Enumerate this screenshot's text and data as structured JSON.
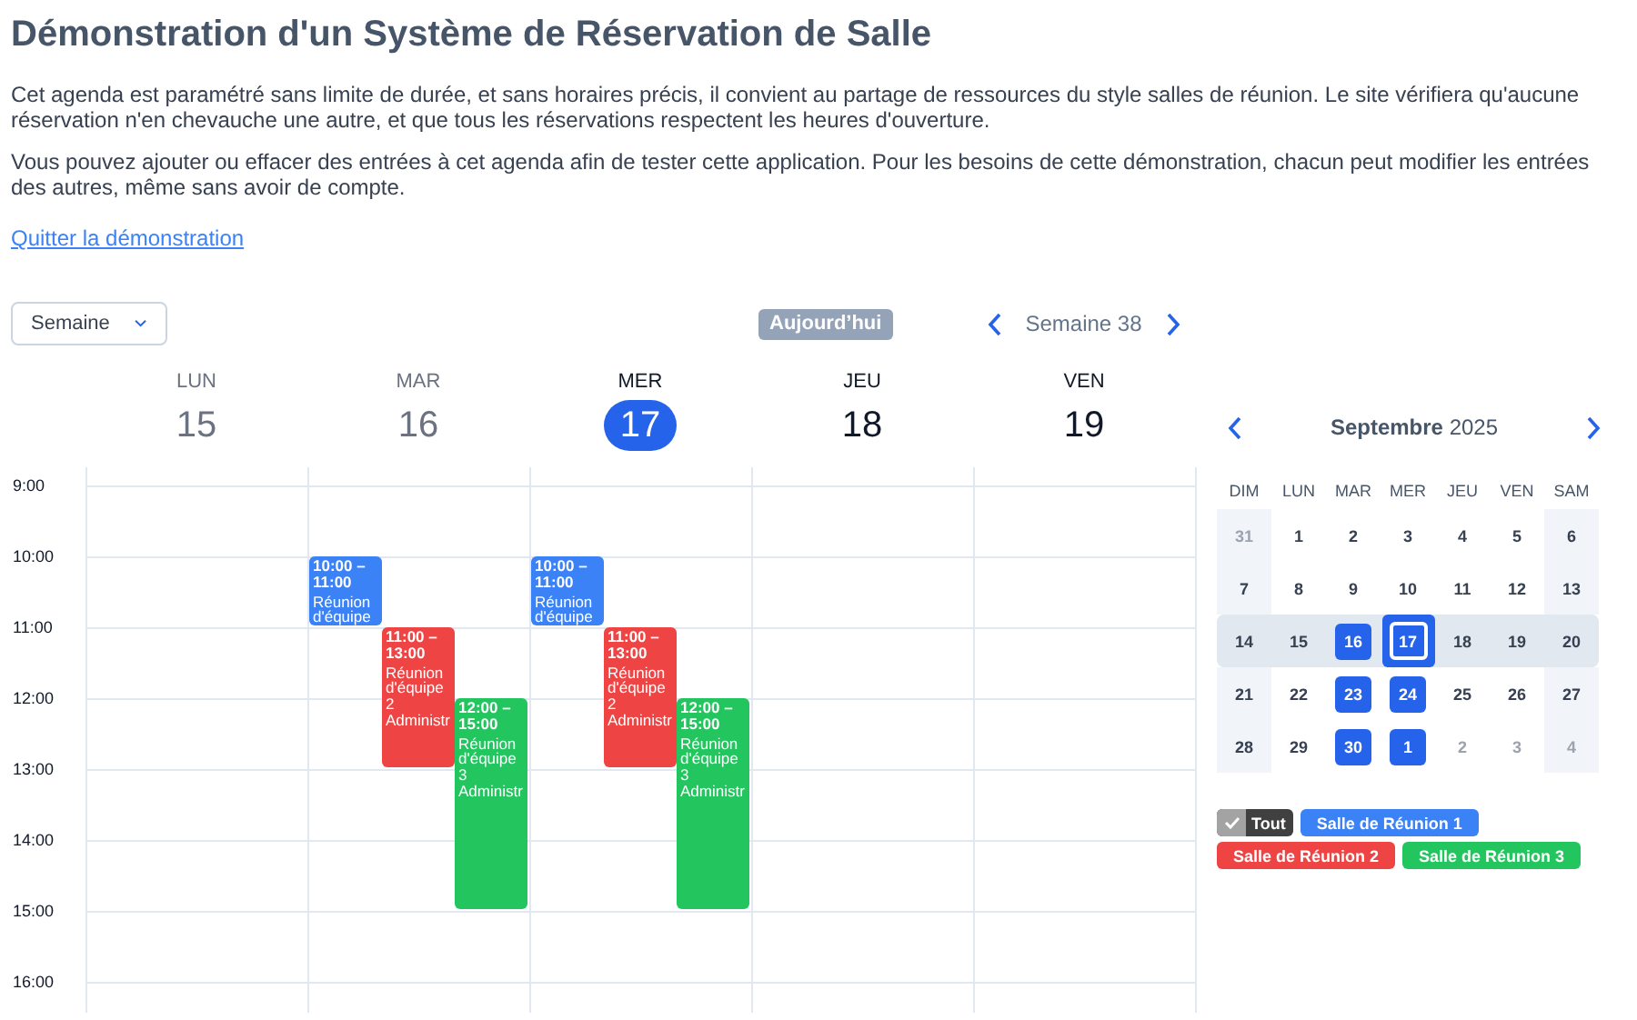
{
  "title": "Démonstration d'un Système de Réservation de Salle",
  "paragraphs": [
    "Cet agenda est paramétré sans limite de durée, et sans horaires précis, il convient au partage de ressources du style salles de réunion. Le site vérifiera qu'aucune réservation n'en chevauche une autre, et que tous les réservations respectent les heures d'ouverture.",
    "Vous pouvez ajouter ou effacer des entrées à cet agenda afin de tester cette application. Pour les besoins de cette démonstration, chacun peut modifier les entrées des autres, même sans avoir de compte."
  ],
  "link": "Quitter la démonstration",
  "toolbar": {
    "view": "Semaine",
    "today": {
      "label": "Aujourd’hui",
      "disabled": true
    },
    "period": "Semaine 38"
  },
  "hours": [
    "9:00",
    "10:00",
    "11:00",
    "12:00",
    "13:00",
    "14:00",
    "15:00",
    "16:00"
  ],
  "days": [
    {
      "name": "LUN",
      "number": "15",
      "kind": "past"
    },
    {
      "name": "MAR",
      "number": "16",
      "kind": "past",
      "events": [
        {
          "time": "10:00 – 11:00",
          "lines": [
            "Réunion d'équipe"
          ],
          "color": "#3b82f6"
        },
        {
          "time": "11:00 – 13:00",
          "lines": [
            "Réunion d'équipe 2",
            "Administr"
          ],
          "color": "#ef4444"
        },
        {
          "time": "12:00 – 15:00",
          "lines": [
            "Réunion d'équipe 3",
            "Administr"
          ],
          "color": "#22c55e"
        }
      ]
    },
    {
      "name": "MER",
      "number": "17",
      "kind": "today",
      "events": [
        {
          "time": "10:00 – 11:00",
          "lines": [
            "Réunion d'équipe"
          ],
          "color": "#3b82f6"
        },
        {
          "time": "11:00 – 13:00",
          "lines": [
            "Réunion d'équipe 2",
            "Administr"
          ],
          "color": "#ef4444"
        },
        {
          "time": "12:00 – 15:00",
          "lines": [
            "Réunion d'équipe 3",
            "Administr"
          ],
          "color": "#22c55e"
        }
      ]
    },
    {
      "name": "JEU",
      "number": "18",
      "kind": "future"
    },
    {
      "name": "VEN",
      "number": "19",
      "kind": "future"
    }
  ],
  "mini_calendar": {
    "month": "Septembre",
    "year": "2025",
    "weekdays": [
      "DIM",
      "LUN",
      "MAR",
      "MER",
      "JEU",
      "VEN",
      "SAM"
    ],
    "weeks": [
      {
        "selected": false,
        "days": [
          {
            "label": "31",
            "other_month": true,
            "has_events": false,
            "selected": false
          },
          {
            "label": "1",
            "other_month": false,
            "has_events": false,
            "selected": false
          },
          {
            "label": "2",
            "other_month": false,
            "has_events": false,
            "selected": false
          },
          {
            "label": "3",
            "other_month": false,
            "has_events": false,
            "selected": false
          },
          {
            "label": "4",
            "other_month": false,
            "has_events": false,
            "selected": false
          },
          {
            "label": "5",
            "other_month": false,
            "has_events": false,
            "selected": false
          },
          {
            "label": "6",
            "other_month": false,
            "has_events": false,
            "selected": false
          }
        ]
      },
      {
        "selected": false,
        "days": [
          {
            "label": "7",
            "other_month": false,
            "has_events": false,
            "selected": false
          },
          {
            "label": "8",
            "other_month": false,
            "has_events": false,
            "selected": false
          },
          {
            "label": "9",
            "other_month": false,
            "has_events": false,
            "selected": false
          },
          {
            "label": "10",
            "other_month": false,
            "has_events": false,
            "selected": false
          },
          {
            "label": "11",
            "other_month": false,
            "has_events": false,
            "selected": false
          },
          {
            "label": "12",
            "other_month": false,
            "has_events": false,
            "selected": false
          },
          {
            "label": "13",
            "other_month": false,
            "has_events": false,
            "selected": false
          }
        ]
      },
      {
        "selected": true,
        "days": [
          {
            "label": "14",
            "other_month": false,
            "has_events": false,
            "selected": false
          },
          {
            "label": "15",
            "other_month": false,
            "has_events": false,
            "selected": false
          },
          {
            "label": "16",
            "other_month": false,
            "has_events": true,
            "selected": false
          },
          {
            "label": "17",
            "other_month": false,
            "has_events": true,
            "selected": true
          },
          {
            "label": "18",
            "other_month": false,
            "has_events": false,
            "selected": false
          },
          {
            "label": "19",
            "other_month": false,
            "has_events": false,
            "selected": false
          },
          {
            "label": "20",
            "other_month": false,
            "has_events": false,
            "selected": false
          }
        ]
      },
      {
        "selected": false,
        "days": [
          {
            "label": "21",
            "other_month": false,
            "has_events": false,
            "selected": false
          },
          {
            "label": "22",
            "other_month": false,
            "has_events": false,
            "selected": false
          },
          {
            "label": "23",
            "other_month": false,
            "has_events": true,
            "selected": false
          },
          {
            "label": "24",
            "other_month": false,
            "has_events": true,
            "selected": false
          },
          {
            "label": "25",
            "other_month": false,
            "has_events": false,
            "selected": false
          },
          {
            "label": "26",
            "other_month": false,
            "has_events": false,
            "selected": false
          },
          {
            "label": "27",
            "other_month": false,
            "has_events": false,
            "selected": false
          }
        ]
      },
      {
        "selected": false,
        "days": [
          {
            "label": "28",
            "other_month": false,
            "has_events": false,
            "selected": false
          },
          {
            "label": "29",
            "other_month": false,
            "has_events": false,
            "selected": false
          },
          {
            "label": "30",
            "other_month": false,
            "has_events": true,
            "selected": false
          },
          {
            "label": "1",
            "other_month": true,
            "has_events": true,
            "selected": false
          },
          {
            "label": "2",
            "other_month": true,
            "has_events": false,
            "selected": false
          },
          {
            "label": "3",
            "other_month": true,
            "has_events": false,
            "selected": false
          },
          {
            "label": "4",
            "other_month": true,
            "has_events": false,
            "selected": false
          }
        ]
      }
    ]
  },
  "filters": [
    {
      "kind": "all",
      "label": "Tout",
      "checked": true
    },
    {
      "kind": "room",
      "label": "Salle de Réunion 1",
      "color": "#3b82f6"
    },
    {
      "kind": "room",
      "label": "Salle de Réunion 2",
      "color": "#ef4444"
    },
    {
      "kind": "room",
      "label": "Salle de Réunion 3",
      "color": "#22c55e"
    }
  ]
}
